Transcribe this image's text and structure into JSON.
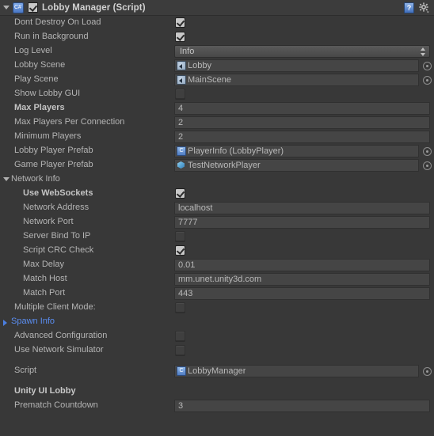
{
  "component": {
    "title": "Lobby Manager (Script)",
    "enabled": true,
    "expanded": true,
    "script_icon": "csharp-script-icon",
    "help_icon": "help-book-icon",
    "settings_icon": "gear-icon"
  },
  "fields": [
    {
      "label": "Dont Destroy On Load",
      "type": "checkbox",
      "value": true,
      "bold": false,
      "indent": 0
    },
    {
      "label": "Run in Background",
      "type": "checkbox",
      "value": true,
      "bold": false,
      "indent": 0
    },
    {
      "label": "Log Level",
      "type": "popup",
      "value": "Info",
      "bold": false,
      "indent": 0
    },
    {
      "label": "Lobby Scene",
      "type": "object",
      "value": "Lobby",
      "icon": "scene-icon",
      "bold": false,
      "indent": 0
    },
    {
      "label": "Play Scene",
      "type": "object",
      "value": "MainScene",
      "icon": "scene-icon",
      "bold": false,
      "indent": 0
    },
    {
      "label": "Show Lobby GUI",
      "type": "checkbox",
      "value": false,
      "bold": false,
      "indent": 0
    },
    {
      "label": "Max Players",
      "type": "text",
      "value": "4",
      "bold": true,
      "indent": 0
    },
    {
      "label": "Max Players Per Connection",
      "type": "text",
      "value": "2",
      "bold": false,
      "indent": 0
    },
    {
      "label": "Minimum Players",
      "type": "text",
      "value": "2",
      "bold": false,
      "indent": 0
    },
    {
      "label": "Lobby Player Prefab",
      "type": "object",
      "value": "PlayerInfo (LobbyPlayer)",
      "icon": "script-icon",
      "bold": false,
      "indent": 0
    },
    {
      "label": "Game Player Prefab",
      "type": "object",
      "value": "TestNetworkPlayer",
      "icon": "prefab-icon",
      "bold": false,
      "indent": 0
    },
    {
      "label": "Network Info",
      "type": "foldout",
      "expanded": true,
      "blue": false,
      "bold": false,
      "indent": 0
    },
    {
      "label": "Use WebSockets",
      "type": "checkbox",
      "value": true,
      "bold": true,
      "indent": 1
    },
    {
      "label": "Network Address",
      "type": "text",
      "value": "localhost",
      "bold": false,
      "indent": 1
    },
    {
      "label": "Network Port",
      "type": "text",
      "value": "7777",
      "bold": false,
      "indent": 1
    },
    {
      "label": "Server Bind To IP",
      "type": "checkbox",
      "value": false,
      "bold": false,
      "indent": 1
    },
    {
      "label": "Script CRC Check",
      "type": "checkbox",
      "value": true,
      "bold": false,
      "indent": 1
    },
    {
      "label": "Max Delay",
      "type": "text",
      "value": "0.01",
      "bold": false,
      "indent": 1
    },
    {
      "label": "Match Host",
      "type": "text",
      "value": "mm.unet.unity3d.com",
      "bold": false,
      "indent": 1
    },
    {
      "label": "Match Port",
      "type": "text",
      "value": "443",
      "bold": false,
      "indent": 1
    },
    {
      "label": "Multiple Client Mode:",
      "type": "checkbox",
      "value": false,
      "bold": false,
      "indent": 0
    },
    {
      "label": "Spawn Info",
      "type": "foldout",
      "expanded": false,
      "blue": true,
      "bold": false,
      "indent": 0
    },
    {
      "label": "Advanced Configuration",
      "type": "checkbox",
      "value": false,
      "bold": false,
      "indent": 0
    },
    {
      "label": "Use Network Simulator",
      "type": "checkbox",
      "value": false,
      "bold": false,
      "indent": 0
    },
    {
      "label": "",
      "type": "spacer",
      "indent": 0
    },
    {
      "label": "Script",
      "type": "object",
      "value": "LobbyManager",
      "icon": "script-icon",
      "bold": false,
      "indent": 0
    },
    {
      "label": "",
      "type": "spacer",
      "indent": 0
    },
    {
      "label": "Unity UI Lobby",
      "type": "section",
      "bold": true,
      "indent": 0
    },
    {
      "label": "Prematch Countdown",
      "type": "text",
      "value": "3",
      "bold": false,
      "indent": 0
    }
  ],
  "colors": {
    "background": "#383838",
    "header_background": "#3c3c3c",
    "label": "#b4b4b4",
    "field_background": "#454545",
    "accent_blue": "#5a8df0",
    "checkbox_checked": "#c8c8c8"
  }
}
